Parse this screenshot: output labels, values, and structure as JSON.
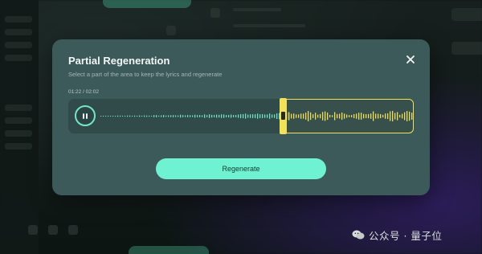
{
  "dialog": {
    "title": "Partial Regeneration",
    "subtitle": "Select a part of the area to keep the lyrics and regenerate",
    "time_readout": "01:22 / 02:02",
    "regenerate_label": "Regenerate",
    "close_icon": "close-icon",
    "play_state_icon": "pause-icon"
  },
  "waveform": {
    "playback_progress": 0.672,
    "selection_start_fraction": 0.62,
    "selection_end_fraction": 1.0,
    "colors": {
      "played": "#6fe3c2",
      "unplayed": "#5f7c79",
      "selected": "#f0de5a"
    }
  },
  "watermark": {
    "text": "公众号 · 量子位"
  },
  "colors": {
    "accent": "#6ff2d1",
    "selection": "#f2e25a",
    "dialog_bg": "#3d5a5a"
  }
}
